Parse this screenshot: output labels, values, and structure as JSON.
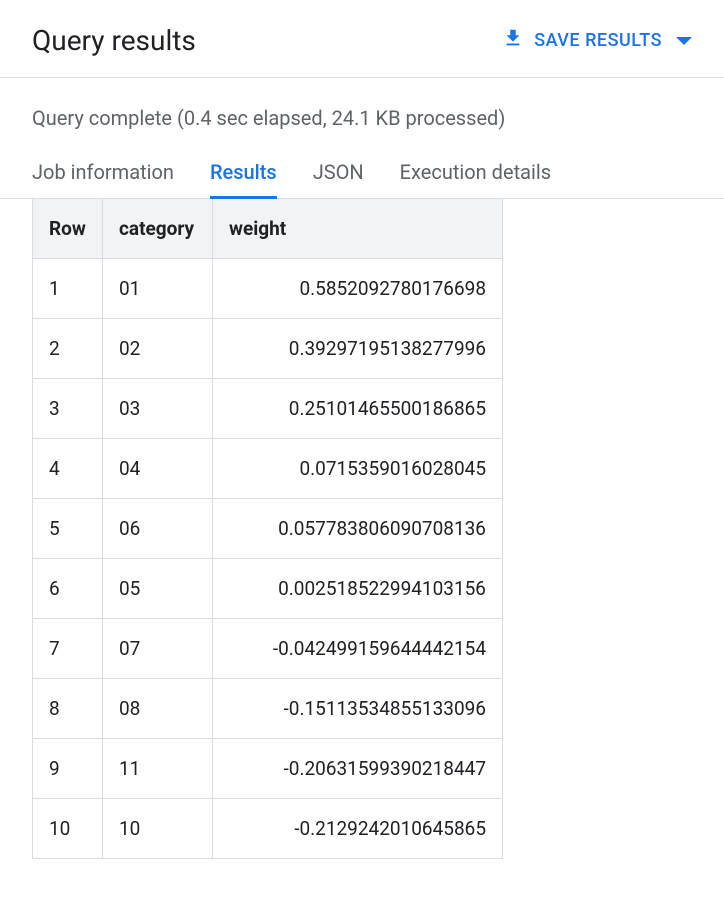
{
  "header": {
    "title": "Query results",
    "save_label": "SAVE RESULTS"
  },
  "status": "Query complete (0.4 sec elapsed, 24.1 KB processed)",
  "tabs": [
    {
      "label": "Job information",
      "active": false
    },
    {
      "label": "Results",
      "active": true
    },
    {
      "label": "JSON",
      "active": false
    },
    {
      "label": "Execution details",
      "active": false
    }
  ],
  "table": {
    "columns": [
      "Row",
      "category",
      "weight"
    ],
    "rows": [
      {
        "row": "1",
        "category": "01",
        "weight": "0.5852092780176698"
      },
      {
        "row": "2",
        "category": "02",
        "weight": "0.39297195138277996"
      },
      {
        "row": "3",
        "category": "03",
        "weight": "0.25101465500186865"
      },
      {
        "row": "4",
        "category": "04",
        "weight": "0.0715359016028045"
      },
      {
        "row": "5",
        "category": "06",
        "weight": "0.057783806090708136"
      },
      {
        "row": "6",
        "category": "05",
        "weight": "0.002518522994103156"
      },
      {
        "row": "7",
        "category": "07",
        "weight": "-0.042499159644442154"
      },
      {
        "row": "8",
        "category": "08",
        "weight": "-0.15113534855133096"
      },
      {
        "row": "9",
        "category": "11",
        "weight": "-0.20631599390218447"
      },
      {
        "row": "10",
        "category": "10",
        "weight": "-0.2129242010645865"
      }
    ]
  }
}
